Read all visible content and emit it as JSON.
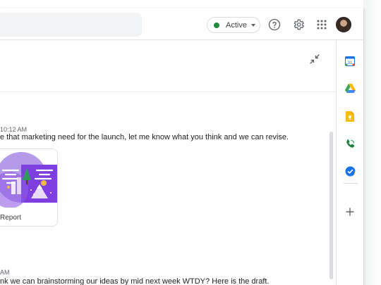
{
  "header": {
    "status_label": "Active"
  },
  "icons": {
    "help": "help-icon",
    "settings": "gear-icon",
    "apps": "apps-grid-icon",
    "avatar": "avatar",
    "exit_fullscreen": "compress-icon"
  },
  "messages": [
    {
      "time": "10:12 AM",
      "text": "e that marketing need for the launch, let me know what you think and we can revise."
    },
    {
      "time": "AM",
      "text": "nk we can brainstorming our ideas by mid next week WTDY? Here is the draft."
    }
  ],
  "attachment": {
    "label": "Report"
  },
  "rail": {
    "calendar_day": "31",
    "items": [
      "calendar-icon",
      "drive-icon",
      "keep-icon",
      "voice-icon",
      "tasks-icon",
      "add-icon"
    ]
  },
  "colors": {
    "status_green": "#1e8e3e",
    "card_purple": "#7e3ee0"
  }
}
